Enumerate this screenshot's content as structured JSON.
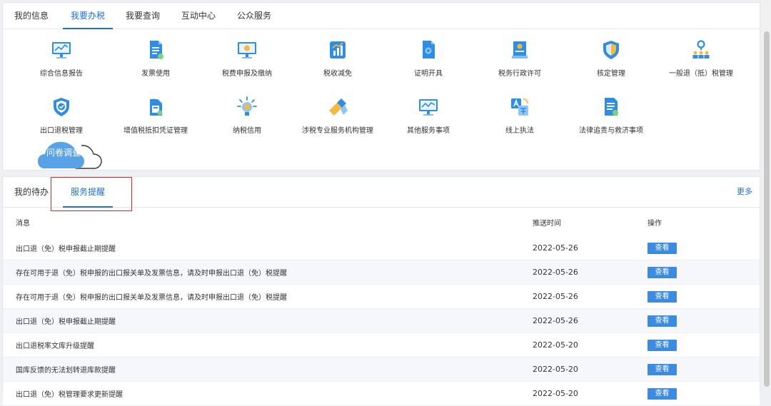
{
  "top_tabs": [
    {
      "label": "我的信息",
      "active": false
    },
    {
      "label": "我要办税",
      "active": true
    },
    {
      "label": "我要查询",
      "active": false
    },
    {
      "label": "互动中心",
      "active": false
    },
    {
      "label": "公众服务",
      "active": false
    }
  ],
  "services_row1": [
    {
      "label": "综合信息报告",
      "icon": "monitor-chart-icon"
    },
    {
      "label": "发票使用",
      "icon": "invoice-document-icon"
    },
    {
      "label": "税费申报及缴纳",
      "icon": "monitor-coin-icon"
    },
    {
      "label": "税收减免",
      "icon": "tax-reduction-chart-icon"
    },
    {
      "label": "证明开具",
      "icon": "certificate-icon"
    },
    {
      "label": "税务行政许可",
      "icon": "license-certificate-icon"
    },
    {
      "label": "核定管理",
      "icon": "shield-icon"
    },
    {
      "label": "一般退（抵）税管理",
      "icon": "location-people-icon"
    }
  ],
  "services_row2": [
    {
      "label": "出口退税管理",
      "icon": "shield-check-icon"
    },
    {
      "label": "增值税抵扣凭证管理",
      "icon": "document-stamp-icon"
    },
    {
      "label": "纳税信用",
      "icon": "lightbulb-icon"
    },
    {
      "label": "涉税专业服务机构管理",
      "icon": "pen-tag-icon"
    },
    {
      "label": "其他服务事项",
      "icon": "monitor-trend-icon"
    },
    {
      "label": "线上执法",
      "icon": "translate-icon"
    },
    {
      "label": "法律追责与救济事项",
      "icon": "legal-document-icon"
    }
  ],
  "survey": {
    "label": "问卷调查"
  },
  "bottom_tabs": [
    {
      "label": "我的待办",
      "active": false
    },
    {
      "label": "服务提醒",
      "active": true
    }
  ],
  "more_label": "更多",
  "table": {
    "headers": [
      "消息",
      "推送时间",
      "操作"
    ],
    "rows": [
      {
        "message": "出口退（免）税申报截止期提醒",
        "time": "2022-05-26",
        "action": "查看"
      },
      {
        "message": "存在可用于退（免）税申报的出口报关单及发票信息，请及时申报出口退（免）税提醒",
        "time": "2022-05-26",
        "action": "查看"
      },
      {
        "message": "存在可用于退（免）税申报的出口报关单及发票信息，请及时申报出口退（免）税提醒",
        "time": "2022-05-26",
        "action": "查看"
      },
      {
        "message": "出口退（免）税申报截止期提醒",
        "time": "2022-05-26",
        "action": "查看"
      },
      {
        "message": "出口退税率文库升级提醒",
        "time": "2022-05-20",
        "action": "查看"
      },
      {
        "message": "国库反馈的无法划转退库款提醒",
        "time": "2022-05-20",
        "action": "查看"
      },
      {
        "message": "出口退（免）税管理要求更新提醒",
        "time": "2022-05-20",
        "action": "查看"
      }
    ]
  },
  "colors": {
    "accent": "#1e6fd9",
    "button": "#3d8be0",
    "highlight": "#d9262b"
  }
}
